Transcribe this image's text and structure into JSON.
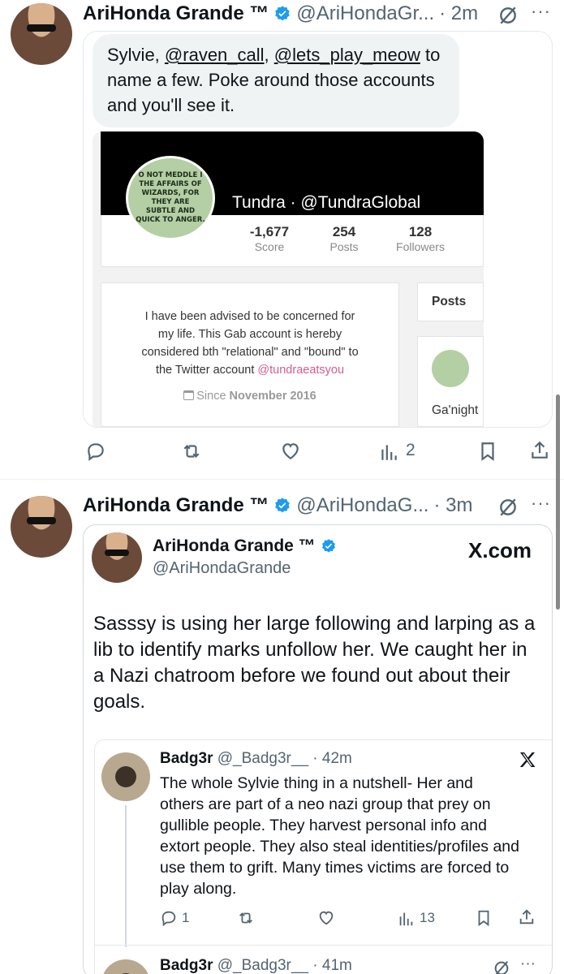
{
  "tweet1": {
    "name": "AriHonda Grande ™",
    "handle": "@AriHondaGr...",
    "time": "· 2m",
    "message_parts": [
      "Sylvie, ",
      "@raven_call",
      ", ",
      "@lets_play_meow",
      " to name a few. Poke around those accounts and you'll see it."
    ],
    "gab": {
      "display_name": "Tundra · @TundraGlobal",
      "avatar_text": "O NOT MEDDLE I THE AFFAIRS OF WIZARDS, FOR THEY ARE SUBTLE AND QUICK TO ANGER.",
      "stats": [
        {
          "num": "-1,677",
          "label": "Score"
        },
        {
          "num": "254",
          "label": "Posts"
        },
        {
          "num": "128",
          "label": "Followers"
        }
      ],
      "bio_lines": [
        "I have been advised to be concerned for",
        "my life. This Gab account is hereby",
        "considered bth \"relational\" and \"bound\" to",
        "the Twitter account "
      ],
      "bio_link": "@tundraeatsyou",
      "since_prefix": "Since ",
      "since_date": "November 2016",
      "posts_tab": "Posts",
      "post_preview": "Ga'night"
    },
    "actions": {
      "views": "2"
    }
  },
  "tweet2": {
    "name": "AriHonda Grande ™",
    "handle": "@AriHondaG...",
    "time": "· 3m",
    "quote": {
      "name": "AriHonda Grande ™",
      "handle": "@AriHondaGrande",
      "brand": "X.com",
      "text": "Sasssy is using her large following and larping as a lib to identify marks unfollow her. We caught her in a Nazi chatroom before we found out about their goals.",
      "embedded": {
        "name": "Badg3r",
        "handle": "@_Badg3r__",
        "time": "· 42m",
        "text": "The whole Sylvie thing in a nutshell-  Her and others are part of a neo nazi group that prey on gullible people. They harvest personal info and extort people. They also steal identities/profiles and use them to grift. Many times victims are forced to play along.",
        "replies": "1",
        "views": "13"
      },
      "next": {
        "name": "Badg3r",
        "handle": "@_Badg3r__",
        "time": "· 41m"
      }
    }
  },
  "colors": {
    "text": "#0f1419",
    "muted": "#536471",
    "verified": "#1d9bf0",
    "link_pink": "#d35d8f",
    "bubble": "#eff3f4"
  }
}
